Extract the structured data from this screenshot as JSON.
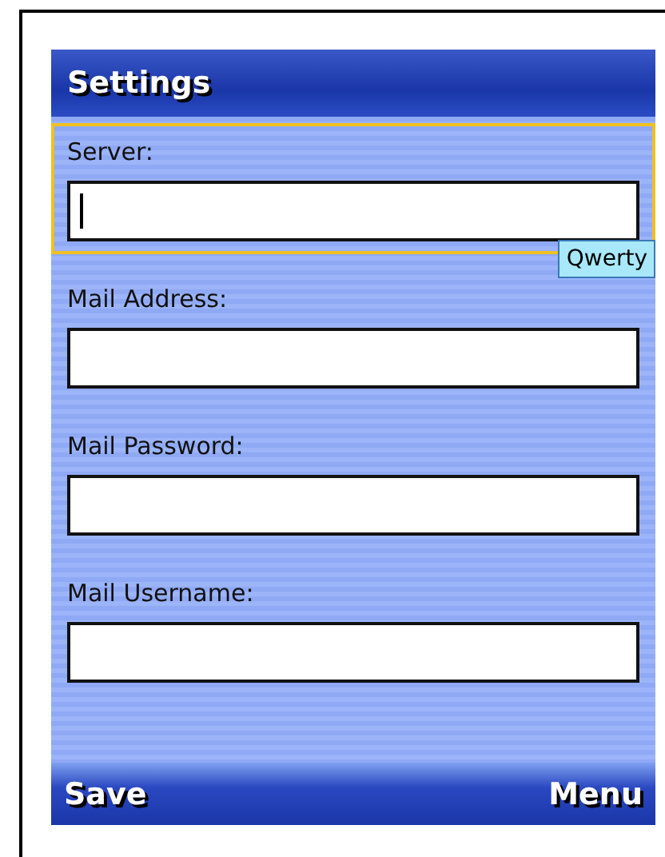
{
  "title": "Settings",
  "fields": [
    {
      "label": "Server:",
      "focused": true
    },
    {
      "label": "Mail Address:",
      "focused": false
    },
    {
      "label": "Mail Password:",
      "focused": false
    },
    {
      "label": "Mail Username:",
      "focused": false
    }
  ],
  "input_mode": "Qwerty",
  "softkeys": {
    "left": "Save",
    "right": "Menu"
  }
}
